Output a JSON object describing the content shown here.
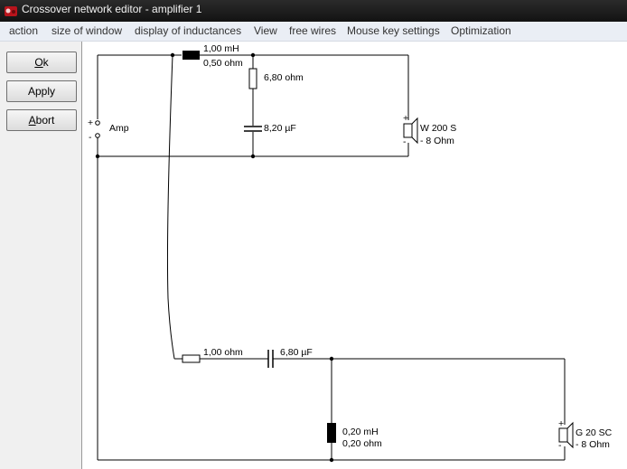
{
  "window": {
    "title": "Crossover network editor - amplifier 1"
  },
  "menu": [
    {
      "id": "action",
      "label": "action"
    },
    {
      "id": "size",
      "label": "size of window"
    },
    {
      "id": "display",
      "label": "display of inductances"
    },
    {
      "id": "view",
      "label": "View"
    },
    {
      "id": "freewires",
      "label": "free wires"
    },
    {
      "id": "mouse",
      "label": "Mouse key settings"
    },
    {
      "id": "opt",
      "label": "Optimization"
    }
  ],
  "buttons": {
    "ok": {
      "accel": "O",
      "rest": "k"
    },
    "apply": {
      "label": "Apply"
    },
    "abort": {
      "accel": "A",
      "rest": "bort"
    }
  },
  "circuit": {
    "amp": {
      "label": "Amp",
      "plus": "+",
      "minus": "-"
    },
    "upper": {
      "inductor": {
        "value1": "1,00 mH",
        "value2": "0,50 ohm"
      },
      "resistor": {
        "value": "6,80 ohm"
      },
      "capacitor": {
        "value": "8,20 µF"
      },
      "speaker": {
        "name": "W 200 S",
        "impedance": "- 8 Ohm",
        "plus": "+",
        "minus": "-"
      }
    },
    "lower": {
      "resistor": {
        "value": "1,00 ohm"
      },
      "capacitor": {
        "value": "6,80 µF"
      },
      "inductor": {
        "value1": "0,20 mH",
        "value2": "0,20 ohm"
      },
      "speaker": {
        "name": "G 20 SC",
        "impedance": "- 8 Ohm",
        "plus": "+",
        "minus": "-"
      }
    }
  },
  "colors": {
    "wire": "#000000",
    "accent_red": "#c0191e"
  }
}
